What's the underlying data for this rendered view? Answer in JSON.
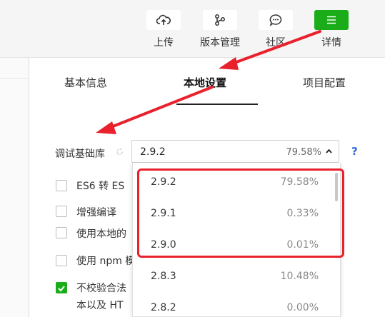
{
  "toolbar": {
    "upload_label": "上传",
    "version_label": "版本管理",
    "community_label": "社区",
    "details_label": "详情"
  },
  "tabs": [
    {
      "label": "基本信息"
    },
    {
      "label": "本地设置"
    },
    {
      "label": "项目配置"
    }
  ],
  "settings": {
    "base_lib_label": "调试基础库",
    "selected_version": "2.9.2",
    "selected_percent": "79.58%",
    "help": "?",
    "options": [
      {
        "label": "ES6 转 ES",
        "checked": false
      },
      {
        "label": "增强编译",
        "checked": false
      },
      {
        "label": "使用本地的",
        "checked": false
      },
      {
        "label": "使用 npm 模",
        "checked": false
      },
      {
        "label": "不校验合法",
        "checked": true
      },
      {
        "label": "本以及 HT",
        "checked": true
      }
    ]
  },
  "dropdown": {
    "items": [
      {
        "version": "2.9.2",
        "percent": "79.58%"
      },
      {
        "version": "2.9.1",
        "percent": "0.33%"
      },
      {
        "version": "2.9.0",
        "percent": "0.01%"
      },
      {
        "version": "2.8.3",
        "percent": "10.48%"
      },
      {
        "version": "2.8.2",
        "percent": "0.00%"
      }
    ]
  },
  "colors": {
    "accent_green": "#1aad19",
    "annotation_red": "#e8212c",
    "help_blue": "#2f6bdb"
  }
}
